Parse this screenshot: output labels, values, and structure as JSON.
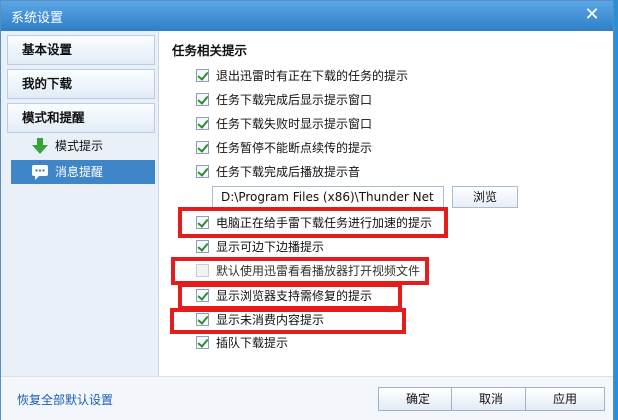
{
  "window": {
    "title": "系统设置",
    "close_glyph": "✕"
  },
  "sidebar": {
    "items": [
      {
        "label": "基本设置"
      },
      {
        "label": "我的下载"
      },
      {
        "label": "模式和提醒"
      }
    ],
    "subitems": [
      {
        "label": "模式提示",
        "icon": "green-down-arrow-icon",
        "selected": false
      },
      {
        "label": "消息提醒",
        "icon": "message-bubble-icon",
        "selected": true
      }
    ]
  },
  "content": {
    "section_title": "任务相关提示",
    "options": [
      {
        "label": "退出迅雷时有正在下载的任务的提示",
        "checked": true
      },
      {
        "label": "任务下载完成后显示提示窗口",
        "checked": true
      },
      {
        "label": "任务下载失败时显示提示窗口",
        "checked": true
      },
      {
        "label": "任务暂停不能断点续传的提示",
        "checked": true
      },
      {
        "label": "任务下载完成后播放提示音",
        "checked": true
      },
      {
        "label": "电脑正在给手雷下载任务进行加速的提示",
        "checked": true
      },
      {
        "label": "显示可边下边播提示",
        "checked": true
      },
      {
        "label": "默认使用迅雷看看播放器打开视频文件",
        "checked": false
      },
      {
        "label": "显示浏览器支持需修复的提示",
        "checked": true
      },
      {
        "label": "显示未消费内容提示",
        "checked": true
      },
      {
        "label": "插队下载提示",
        "checked": true
      }
    ],
    "sound_path": "D:\\Program Files (x86)\\Thunder Net",
    "browse_label": "浏览"
  },
  "footer": {
    "restore_label": "恢复全部默认设置",
    "ok_label": "确定",
    "cancel_label": "取消",
    "apply_label": "应用"
  },
  "colors": {
    "highlight": "#e51c1c",
    "accent": "#3f86c8"
  }
}
